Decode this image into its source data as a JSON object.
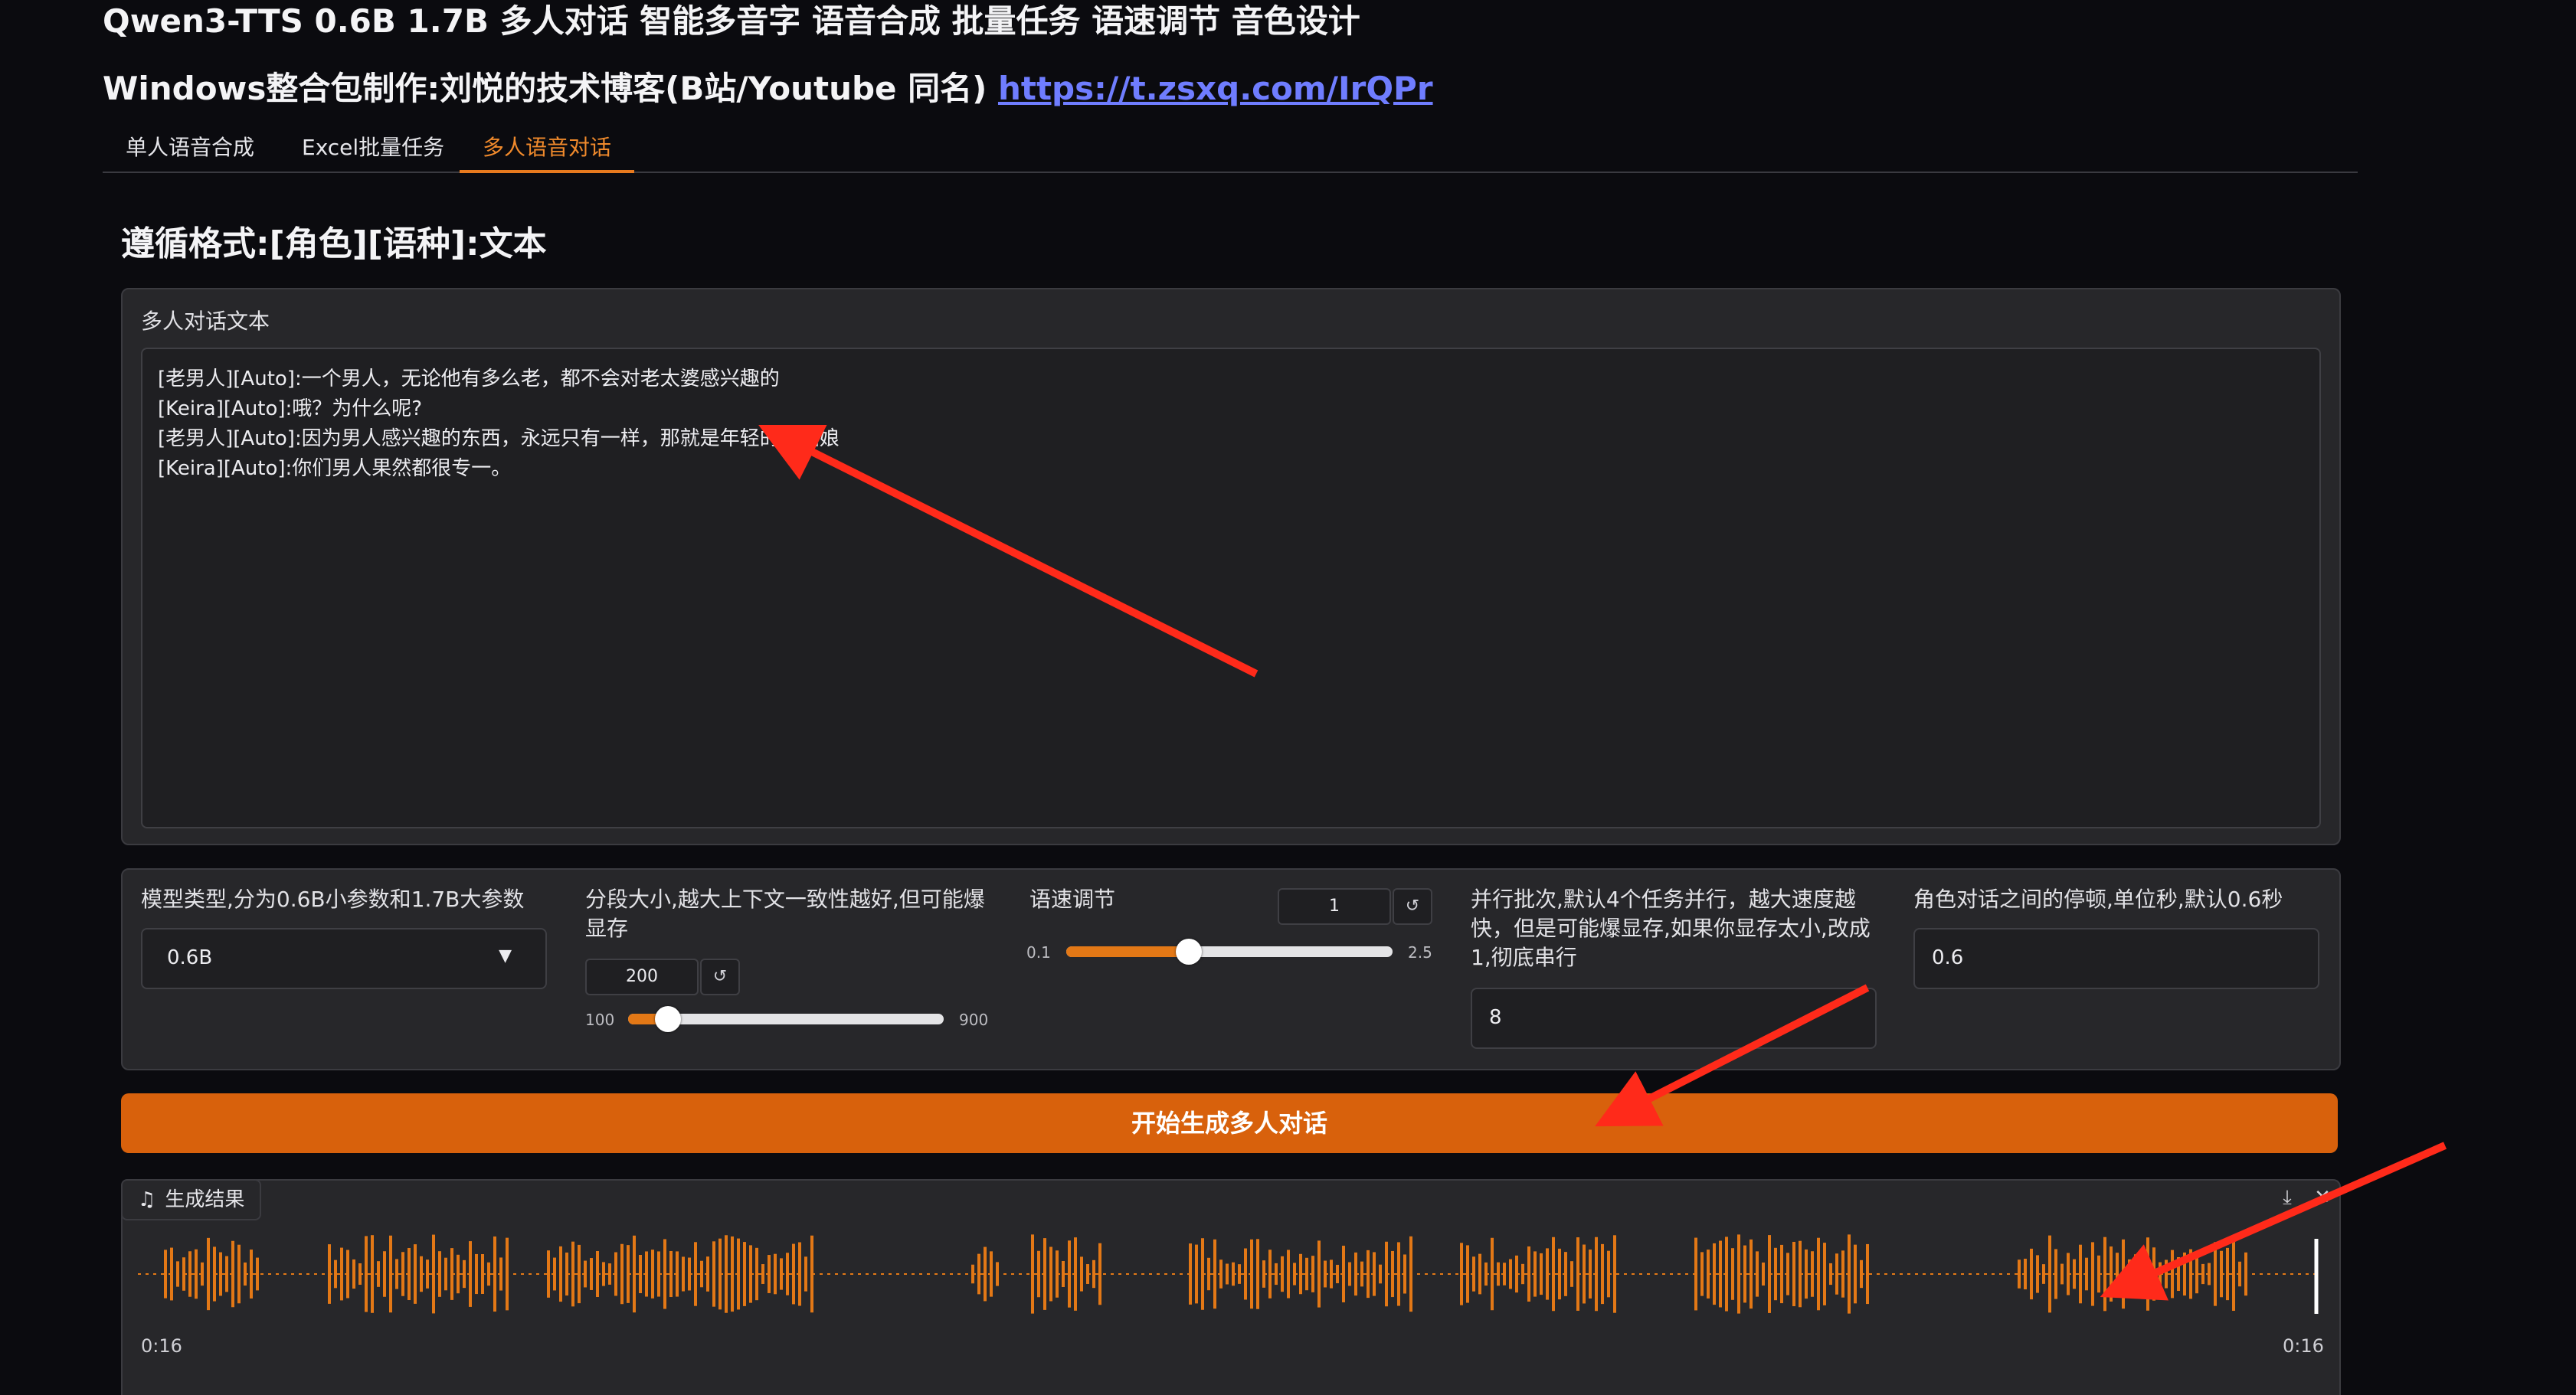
{
  "header": {
    "title": "Qwen3-TTS 0.6B 1.7B 多人对话 智能多音字 语音合成 批量任务 语速调节 音色设计",
    "subtitle_prefix": "Windows整合包制作:刘悦的技术博客(B站/Youtube 同名) ",
    "subtitle_link": "https://t.zsxq.com/IrQPr"
  },
  "tabs": [
    {
      "label": "单人语音合成",
      "active": false
    },
    {
      "label": "Excel批量任务",
      "active": false
    },
    {
      "label": "多人语音对话",
      "active": true
    }
  ],
  "section_title": "遵循格式:[角色][语种]:文本",
  "dialog_panel": {
    "label": "多人对话文本",
    "lines": [
      "[老男人][Auto]:一个男人，无论他有多么老，都不会对老太婆感兴趣的",
      "[Keira][Auto]:哦？为什么呢?",
      "[老男人][Auto]:因为男人感兴趣的东西，永远只有一样，那就是年轻的小姑娘",
      "[Keira][Auto]:你们男人果然都很专一。"
    ]
  },
  "controls": {
    "model_type": {
      "label": "模型类型,分为0.6B小参数和1.7B大参数",
      "value": "0.6B"
    },
    "segment_size": {
      "label": "分段大小,越大上下文一致性越好,但可能爆显存",
      "value": "200",
      "min": "100",
      "max": "900",
      "fraction": 0.125
    },
    "speed": {
      "label": "语速调节",
      "value": "1",
      "min": "0.1",
      "max": "2.5",
      "fraction": 0.375
    },
    "parallel": {
      "label": "并行批次,默认4个任务并行，越大速度越快，但是可能爆显存,如果你显存太小,改成1,彻底串行",
      "value": "8"
    },
    "pause": {
      "label": "角色对话之间的停顿,单位秒,默认0.6秒",
      "value": "0.6"
    }
  },
  "generate_button": "开始生成多人对话",
  "result": {
    "label": "生成结果",
    "time_start": "0:16",
    "time_end": "0:16",
    "wave_color": "#e37816"
  },
  "icons": {
    "dropdown": "caret-down-icon",
    "reset": "reset-icon",
    "music": "music-note-icon",
    "download": "download-icon",
    "clear": "close-icon"
  },
  "colors": {
    "accent": "#d8610c",
    "annotation_arrow": "#ff2a1a",
    "link": "#6f7dff"
  }
}
